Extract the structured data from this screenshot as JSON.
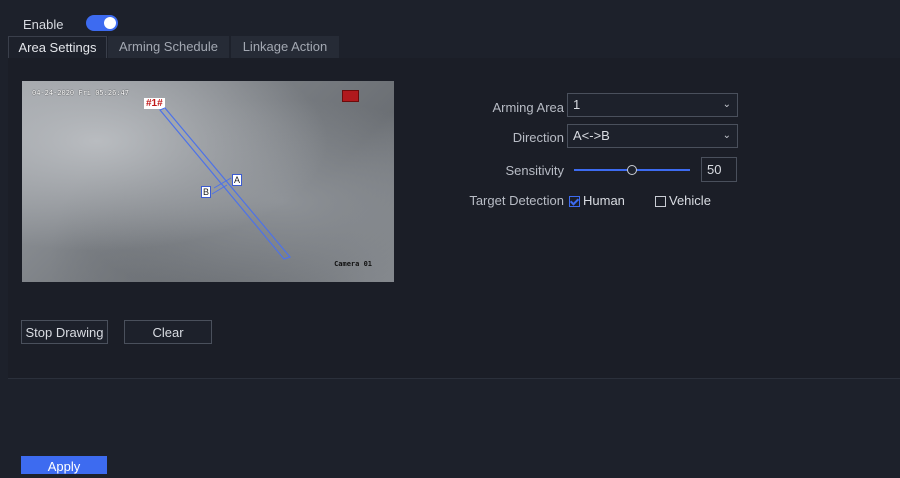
{
  "header": {
    "enable_label": "Enable",
    "enabled": true
  },
  "tabs": [
    {
      "label": "Area Settings",
      "active": true
    },
    {
      "label": "Arming Schedule",
      "active": false
    },
    {
      "label": "Linkage Action",
      "active": false
    }
  ],
  "video": {
    "timestamp": "04-24-2020 Fri 05:26:47",
    "camera_name": "Camera 01",
    "line_tag": "#1#",
    "dir_a": "A",
    "dir_b": "B",
    "rec_icon": "record-icon"
  },
  "buttons": {
    "stop_drawing": "Stop Drawing",
    "clear": "Clear",
    "apply": "Apply"
  },
  "form": {
    "arming_area_label": "Arming Area",
    "arming_area_value": "1",
    "direction_label": "Direction",
    "direction_value": "A<->B",
    "sensitivity_label": "Sensitivity",
    "sensitivity_value": "50",
    "target_detection_label": "Target Detection",
    "human_label": "Human",
    "human_checked": true,
    "vehicle_label": "Vehicle",
    "vehicle_checked": false
  },
  "colors": {
    "accent": "#3d6bf0",
    "background": "#1d212b"
  }
}
